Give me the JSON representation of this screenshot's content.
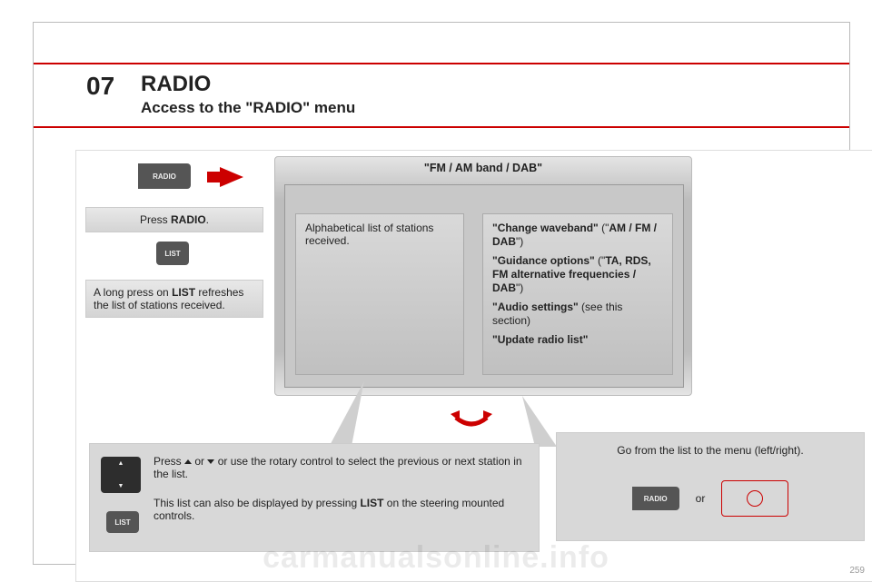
{
  "chapter": {
    "number": "07",
    "title": "RADIO",
    "subtitle": "Access to the \"RADIO\" menu"
  },
  "buttons": {
    "radio_label": "RADIO",
    "list_label": "LIST"
  },
  "left": {
    "press_radio_pre": "Press ",
    "press_radio_bold": "RADIO",
    "press_radio_post": ".",
    "long_press_pre": "A long press on ",
    "long_press_bold": "LIST",
    "long_press_post": " refreshes the list of stations received."
  },
  "screen": {
    "title": "\"FM / AM band / DAB\"",
    "left_pane": "Alphabetical list of stations received.",
    "r1_bold": "\"Change waveband\"",
    "r1_rest": " (\"",
    "r1_bold2": "AM / FM / DAB",
    "r1_end": "\")",
    "r2_bold": "\"Guidance options\"",
    "r2_rest": " (\"",
    "r2_bold2": "TA, RDS, FM alternative frequencies / DAB",
    "r2_end": "\")",
    "r3_bold": "\"Audio settings\"",
    "r3_rest": " (see this section)",
    "r4_bold": "\"Update radio list\""
  },
  "callout_a": {
    "line1_pre": "Press ",
    "line1_mid": " or ",
    "line1_post": " or use the rotary control to select the previous or next station in the list.",
    "line2_pre": "This list can also be displayed by pressing ",
    "line2_bold": "LIST",
    "line2_post": " on the steering mounted controls."
  },
  "callout_b": {
    "go_text": "Go from the list to the menu (left/right).",
    "or": "or"
  },
  "watermark": "carmanualsonline.info",
  "page_number": "259"
}
